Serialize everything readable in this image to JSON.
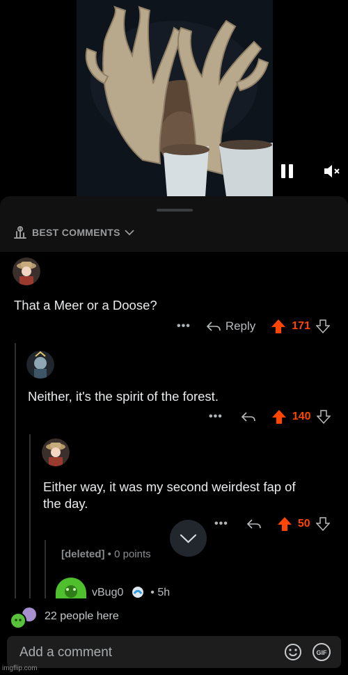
{
  "video": {
    "pause_icon": "pause-icon",
    "mute_icon": "mute-icon"
  },
  "sort": {
    "label": "BEST COMMENTS",
    "icon": "sort-icon"
  },
  "comments": [
    {
      "text": "That a Meer or a Doose?",
      "dots": "•••",
      "reply_label": "Reply",
      "score": "171"
    },
    {
      "text": "Neither, it's the spirit of the forest.",
      "dots": "•••",
      "score": "140"
    },
    {
      "text_line1": "Either way, it was my second weirdest fap of",
      "text_line2": "the day.",
      "dots": "•••",
      "score": "50"
    }
  ],
  "deleted": {
    "author": "[deleted]",
    "meta": " • 0 points"
  },
  "next_user": {
    "name": "vBug0",
    "time": "• 5h"
  },
  "presence": {
    "text": "22 people here"
  },
  "composer": {
    "placeholder": "Add a comment"
  },
  "watermark": "imgflip.com",
  "colors": {
    "upvote": "#ff4500",
    "background": "#000000",
    "surface": "#1d1d1d"
  }
}
